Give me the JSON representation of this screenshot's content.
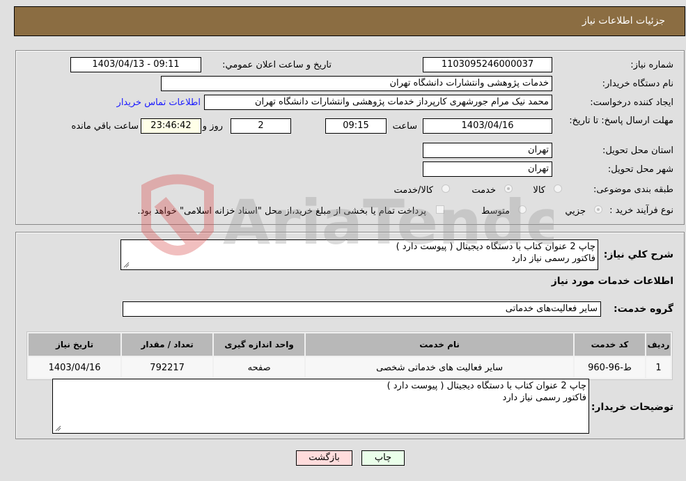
{
  "header": {
    "title": "جزئیات اطلاعات نیاز"
  },
  "form": {
    "need_number": {
      "label": "شماره نیاز:",
      "value": "1103095246000037"
    },
    "announce_datetime": {
      "label": "تاریخ و ساعت اعلان عمومي:",
      "value": "1403/04/13 - 09:11"
    },
    "buyer_org": {
      "label": "نام دستگاه خریدار:",
      "value": "خدمات پژوهشی وانتشارات دانشگاه تهران"
    },
    "requester": {
      "label": "ایجاد کننده درخواست:",
      "value": "محمد نیک مرام جورشهری کارپرداز خدمات پژوهشی وانتشارات دانشگاه تهران",
      "contact_link": "اطلاعات تماس خریدار"
    },
    "deadline": {
      "label": "مهلت ارسال پاسخ: تا تاریخ:",
      "date": "1403/04/16",
      "time_label": "ساعت",
      "time": "09:15",
      "days": "2",
      "days_label": "روز و",
      "remaining": "23:46:42",
      "remaining_label": "ساعت باقي مانده"
    },
    "province": {
      "label": "استان محل تحویل:",
      "value": "تهران"
    },
    "city": {
      "label": "شهر محل تحویل:",
      "value": "تهران"
    },
    "category": {
      "label": "طبقه بندی موضوعی:",
      "options": [
        {
          "label": "کالا",
          "selected": false
        },
        {
          "label": "خدمت",
          "selected": true
        },
        {
          "label": "کالا/خدمت",
          "selected": false
        }
      ]
    },
    "purchase_process": {
      "label": "نوع فرآیند خرید :",
      "options": [
        {
          "label": "جزيي",
          "selected": true
        },
        {
          "label": "متوسط",
          "selected": false
        }
      ],
      "checkbox_label": "پرداخت تمام یا بخشی از مبلغ خرید،از محل \"اسناد خزانه اسلامی\" خواهد بود.",
      "checkbox_checked": false
    }
  },
  "description": {
    "label": "شرح کلي نیاز:",
    "line1": "چاپ 2 عنوان کتاب با دستگاه دیجیتال ( پیوست دارد )",
    "line2": "فاکتور رسمی نیاز دارد"
  },
  "services_section": {
    "title": "اطلاعات خدمات مورد نیاز",
    "group_label": "گروه خدمت:",
    "group_value": "سایر فعالیت‌های خدماتی"
  },
  "table": {
    "headers": [
      "ردیف",
      "کد خدمت",
      "نام خدمت",
      "واحد اندازه گیری",
      "تعداد / مقدار",
      "تاریخ نیاز"
    ],
    "rows": [
      [
        "1",
        "ط-96-960",
        "سایر فعالیت های خدماتی شخصی",
        "صفحه",
        "792217",
        "1403/04/16"
      ]
    ]
  },
  "buyer_notes": {
    "label": "توضیحات خریدار:",
    "line1": "چاپ 2 عنوان کتاب با دستگاه دیجیتال ( پیوست دارد )",
    "line2": "فاکتور رسمی نیاز دارد"
  },
  "buttons": {
    "print": "چاپ",
    "back": "بازگشت"
  },
  "watermark": {
    "text": "AriaTender.neT"
  },
  "colors": {
    "header_bg": "#8b6d42",
    "link": "#1a1aff",
    "print_btn_bg": "#eaffea",
    "back_btn_bg": "#ffdcdc",
    "remaining_bg": "#ffffe8"
  }
}
